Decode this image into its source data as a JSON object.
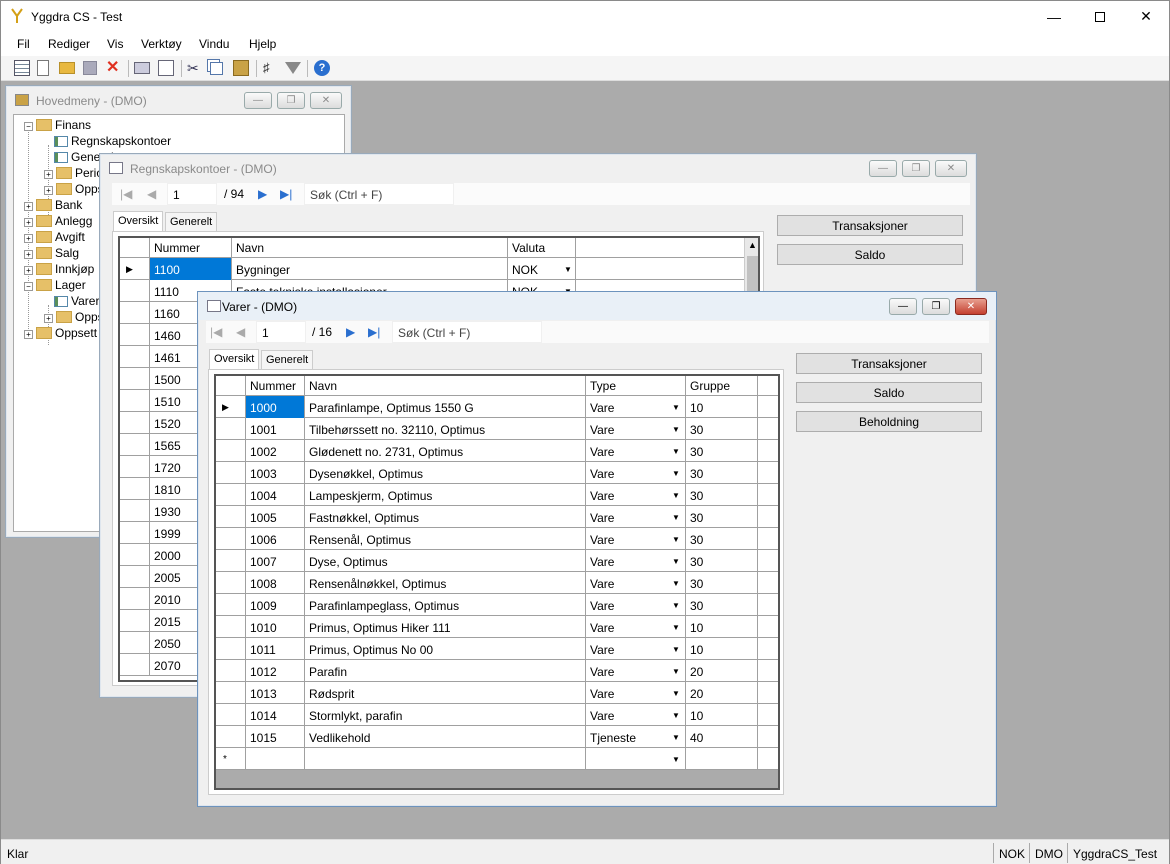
{
  "app": {
    "title": "Yggdra CS - Test"
  },
  "menu": [
    "Fil",
    "Rediger",
    "Vis",
    "Verktøy",
    "Vindu",
    "Hjelp"
  ],
  "toolbar_icons": [
    "grid-icon",
    "new-icon",
    "open-icon",
    "save-icon",
    "delete-icon",
    "print-icon",
    "print-preview-icon",
    "cut-icon",
    "copy-icon",
    "paste-icon",
    "tree-icon",
    "filter-icon",
    "help-icon"
  ],
  "status": {
    "left": "Klar",
    "currency": "NOK",
    "company": "DMO",
    "db": "YggdraCS_Test"
  },
  "hovedmeny": {
    "title": "Hovedmeny - (DMO)",
    "tree": [
      {
        "label": "Finans",
        "expanded": true,
        "level": 0
      },
      {
        "label": "Regnskapskontoer",
        "level": 1,
        "leaf": true
      },
      {
        "label": "Generelt",
        "level": 1,
        "leaf": true
      },
      {
        "label": "Perioder",
        "level": 1
      },
      {
        "label": "Oppsett",
        "level": 1
      },
      {
        "label": "Bank",
        "level": 0
      },
      {
        "label": "Anlegg",
        "level": 0
      },
      {
        "label": "Avgift",
        "level": 0
      },
      {
        "label": "Salg",
        "level": 0
      },
      {
        "label": "Innkjøp",
        "level": 0
      },
      {
        "label": "Lager",
        "expanded": true,
        "level": 0
      },
      {
        "label": "Varer",
        "level": 1,
        "leaf": true
      },
      {
        "label": "Oppsett",
        "level": 1
      },
      {
        "label": "Oppsett",
        "level": 0
      }
    ]
  },
  "regnskap": {
    "title": "Regnskapskontoer - (DMO)",
    "nav": {
      "position": "1",
      "total": "/ 94",
      "search": "Søk (Ctrl + F)"
    },
    "tabs": [
      "Oversikt",
      "Generelt"
    ],
    "buttons": [
      "Transaksjoner",
      "Saldo"
    ],
    "columns": [
      "Nummer",
      "Navn",
      "Valuta"
    ],
    "rows": [
      {
        "nr": "1100",
        "navn": "Bygninger",
        "valuta": "NOK"
      },
      {
        "nr": "1110",
        "navn": "Faste tekniske installasjoner",
        "valuta": "NOK"
      },
      {
        "nr": "1160",
        "navn": "",
        "valuta": ""
      },
      {
        "nr": "1460",
        "navn": "",
        "valuta": ""
      },
      {
        "nr": "1461",
        "navn": "",
        "valuta": ""
      },
      {
        "nr": "1500",
        "navn": "",
        "valuta": ""
      },
      {
        "nr": "1510",
        "navn": "",
        "valuta": ""
      },
      {
        "nr": "1520",
        "navn": "",
        "valuta": ""
      },
      {
        "nr": "1565",
        "navn": "",
        "valuta": ""
      },
      {
        "nr": "1720",
        "navn": "",
        "valuta": ""
      },
      {
        "nr": "1810",
        "navn": "",
        "valuta": ""
      },
      {
        "nr": "1930",
        "navn": "",
        "valuta": ""
      },
      {
        "nr": "1999",
        "navn": "",
        "valuta": ""
      },
      {
        "nr": "2000",
        "navn": "",
        "valuta": ""
      },
      {
        "nr": "2005",
        "navn": "",
        "valuta": ""
      },
      {
        "nr": "2010",
        "navn": "",
        "valuta": ""
      },
      {
        "nr": "2015",
        "navn": "",
        "valuta": ""
      },
      {
        "nr": "2050",
        "navn": "",
        "valuta": ""
      },
      {
        "nr": "2070",
        "navn": "",
        "valuta": ""
      }
    ]
  },
  "varer": {
    "title": "Varer - (DMO)",
    "nav": {
      "position": "1",
      "total": "/ 16",
      "search": "Søk (Ctrl + F)"
    },
    "tabs": [
      "Oversikt",
      "Generelt"
    ],
    "buttons": [
      "Transaksjoner",
      "Saldo",
      "Beholdning"
    ],
    "columns": [
      "Nummer",
      "Navn",
      "Type",
      "Gruppe"
    ],
    "rows": [
      {
        "nr": "1000",
        "navn": "Parafinlampe, Optimus 1550 G",
        "type": "Vare",
        "gruppe": "10"
      },
      {
        "nr": "1001",
        "navn": "Tilbehørssett no. 32110, Optimus",
        "type": "Vare",
        "gruppe": "30"
      },
      {
        "nr": "1002",
        "navn": "Glødenett no. 2731, Optimus",
        "type": "Vare",
        "gruppe": "30"
      },
      {
        "nr": "1003",
        "navn": "Dysenøkkel, Optimus",
        "type": "Vare",
        "gruppe": "30"
      },
      {
        "nr": "1004",
        "navn": "Lampeskjerm, Optimus",
        "type": "Vare",
        "gruppe": "30"
      },
      {
        "nr": "1005",
        "navn": "Fastnøkkel, Optimus",
        "type": "Vare",
        "gruppe": "30"
      },
      {
        "nr": "1006",
        "navn": "Rensenål, Optimus",
        "type": "Vare",
        "gruppe": "30"
      },
      {
        "nr": "1007",
        "navn": "Dyse, Optimus",
        "type": "Vare",
        "gruppe": "30"
      },
      {
        "nr": "1008",
        "navn": "Rensenålnøkkel, Optimus",
        "type": "Vare",
        "gruppe": "30"
      },
      {
        "nr": "1009",
        "navn": "Parafinlampeglass, Optimus",
        "type": "Vare",
        "gruppe": "30"
      },
      {
        "nr": "1010",
        "navn": "Primus, Optimus Hiker 111",
        "type": "Vare",
        "gruppe": "10"
      },
      {
        "nr": "1011",
        "navn": "Primus, Optimus No 00",
        "type": "Vare",
        "gruppe": "10"
      },
      {
        "nr": "1012",
        "navn": "Parafin",
        "type": "Vare",
        "gruppe": "20"
      },
      {
        "nr": "1013",
        "navn": "Rødsprit",
        "type": "Vare",
        "gruppe": "20"
      },
      {
        "nr": "1014",
        "navn": "Stormlykt, parafin",
        "type": "Vare",
        "gruppe": "10"
      },
      {
        "nr": "1015",
        "navn": "Vedlikehold",
        "type": "Tjeneste",
        "gruppe": "40"
      }
    ]
  }
}
